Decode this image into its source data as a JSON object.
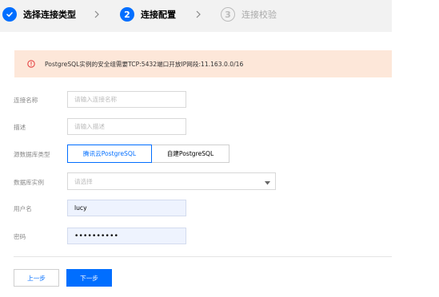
{
  "steps": [
    {
      "label": "选择连接类型",
      "state": "done"
    },
    {
      "number": "2",
      "label": "连接配置",
      "state": "active"
    },
    {
      "number": "3",
      "label": "连接校验",
      "state": "pending"
    }
  ],
  "alert": {
    "text": "PostgreSQL实例的安全组需要TCP:5432端口开放IP网段:11.163.0.0/16"
  },
  "form": {
    "connection_name": {
      "label": "连接名称",
      "placeholder": "请输入连接名称"
    },
    "description": {
      "label": "描述",
      "placeholder": "请输入描述"
    },
    "source_type": {
      "label": "源数据库类型",
      "options": [
        "腾讯云PostgreSQL",
        "自建PostgreSQL"
      ],
      "selected": "腾讯云PostgreSQL"
    },
    "instance": {
      "label": "数据库实例",
      "placeholder": "请选择"
    },
    "username": {
      "label": "用户名",
      "value": "lucy"
    },
    "password": {
      "label": "密码",
      "value": "••••••••••"
    }
  },
  "buttons": {
    "prev": "上一步",
    "next": "下一步"
  },
  "colors": {
    "primary": "#006eff",
    "alert_bg": "#fde7d9",
    "alert_icon": "#e54545",
    "filled_input_bg": "#eef3fe"
  }
}
